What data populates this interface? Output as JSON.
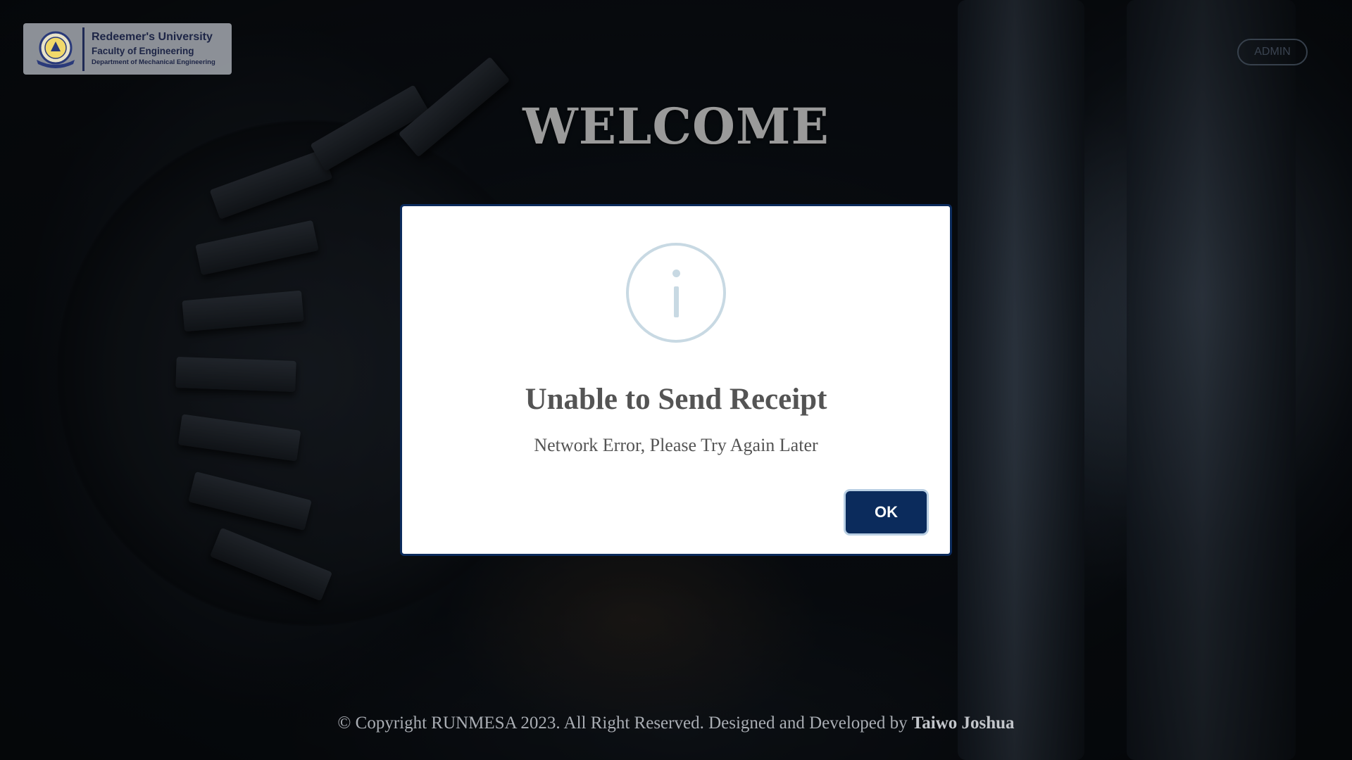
{
  "header": {
    "logo": {
      "university": "Redeemer's University",
      "faculty": "Faculty of Engineering",
      "department": "Department of Mechanical Engineering"
    },
    "admin_label": "ADMIN"
  },
  "main": {
    "welcome": "WELCOME"
  },
  "dialog": {
    "icon": "info-icon",
    "title": "Unable to Send Receipt",
    "message": "Network Error, Please Try Again Later",
    "ok_label": "OK"
  },
  "footer": {
    "text": "© Copyright RUNMESA 2023. All Right Reserved. Designed and Developed by",
    "author": "Taiwo Joshua"
  },
  "colors": {
    "dialog_border": "#0b2b5c",
    "ok_button": "#0b2b5c",
    "info_icon": "#c8d9e3",
    "dialog_text": "#545454",
    "dim_overlay": "#000000"
  }
}
